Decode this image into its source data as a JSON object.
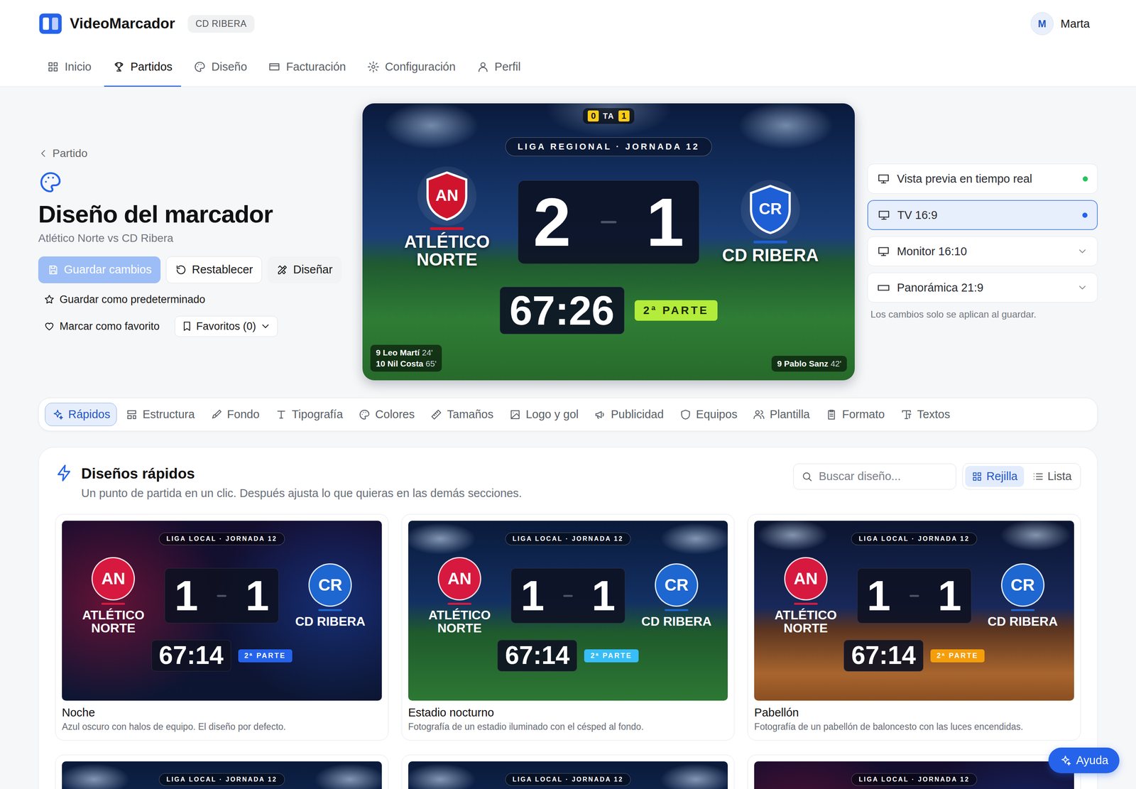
{
  "app": {
    "brand": "VideoMarcador",
    "club": "CD RIBERA",
    "user": {
      "initial": "M",
      "name": "Marta"
    }
  },
  "nav": [
    {
      "label": "Inicio",
      "selected": false
    },
    {
      "label": "Partidos",
      "selected": true
    },
    {
      "label": "Diseño",
      "selected": false
    },
    {
      "label": "Facturación",
      "selected": false
    },
    {
      "label": "Configuración",
      "selected": false
    },
    {
      "label": "Perfil",
      "selected": false
    }
  ],
  "page": {
    "back": "Partido",
    "title": "Diseño del marcador",
    "subtitle": "Atlético Norte vs CD Ribera"
  },
  "actions": {
    "save": {
      "label": "Guardar cambios",
      "disabled": true
    },
    "reset": "Restablecer",
    "design": "Diseñar",
    "default": "Guardar como predeterminado",
    "favorite": "Marcar como favorito",
    "favorites": "Favoritos (0)"
  },
  "preview": {
    "timeouts": {
      "home": "0",
      "label": "TA",
      "away": "1"
    },
    "competition": "LIGA REGIONAL · JORNADA 12",
    "home": {
      "initials": "AN",
      "name": "ATLÉTICO NORTE",
      "color": "#d0142e",
      "scorers": [
        {
          "name": "9 Leo Martí",
          "minute": "24'"
        },
        {
          "name": "10 Nil Costa",
          "minute": "65'"
        }
      ]
    },
    "away": {
      "initials": "CR",
      "name": "CD RIBERA",
      "color": "#1e5fd6",
      "scorers": [
        {
          "name": "9 Pablo Sanz",
          "minute": "42'"
        }
      ]
    },
    "score": {
      "home": "2",
      "away": "1"
    },
    "clock": "67:26",
    "period": "2ª PARTE"
  },
  "screens": {
    "live": {
      "label": "Vista previa en tiempo real",
      "on": true,
      "color": "#22c55e"
    },
    "items": [
      {
        "label": "TV 16:9",
        "selected": true
      },
      {
        "label": "Monitor 16:10",
        "selected": false
      },
      {
        "label": "Panorámica 21:9",
        "selected": false
      }
    ],
    "note": "Los cambios solo se aplican al guardar."
  },
  "sections": [
    {
      "label": "Rápidos",
      "selected": true
    },
    {
      "label": "Estructura",
      "selected": false
    },
    {
      "label": "Fondo",
      "selected": false
    },
    {
      "label": "Tipografía",
      "selected": false
    },
    {
      "label": "Colores",
      "selected": false
    },
    {
      "label": "Tamaños",
      "selected": false
    },
    {
      "label": "Logo y gol",
      "selected": false
    },
    {
      "label": "Publicidad",
      "selected": false
    },
    {
      "label": "Equipos",
      "selected": false
    },
    {
      "label": "Plantilla",
      "selected": false
    },
    {
      "label": "Formato",
      "selected": false
    },
    {
      "label": "Textos",
      "selected": false
    }
  ],
  "quick": {
    "title": "Diseños rápidos",
    "subtitle": "Un punto de partida en un clic. Después ajusta lo que quieras en las demás secciones.",
    "search": "Buscar diseño...",
    "views": [
      {
        "label": "Rejilla",
        "selected": true
      },
      {
        "label": "Lista",
        "selected": false
      }
    ],
    "designs": [
      {
        "name": "Noche",
        "description": "Azul oscuro con halos de equipo. El diseño por defecto.",
        "kind": "night",
        "competition": "LIGA LOCAL · JORNADA 12",
        "home": {
          "initials": "AN",
          "name": "ATLÉTICO NORTE",
          "color": "#d7193f"
        },
        "away": {
          "initials": "CR",
          "name": "CD RIBERA",
          "color": "#1e66d0"
        },
        "score": [
          "1",
          "1"
        ],
        "clock": "67:14",
        "period": "2ª PARTE",
        "color": "#2563eb"
      },
      {
        "name": "Estadio nocturno",
        "description": "Fotografía de un estadio iluminado con el césped al fondo.",
        "kind": "stadium",
        "competition": "LIGA LOCAL · JORNADA 12",
        "home": {
          "initials": "AN",
          "name": "ATLÉTICO NORTE",
          "color": "#d7193f"
        },
        "away": {
          "initials": "CR",
          "name": "CD RIBERA",
          "color": "#1e66d0"
        },
        "score": [
          "1",
          "1"
        ],
        "clock": "67:14",
        "period": "2ª PARTE",
        "color": "#38bdf8"
      },
      {
        "name": "Pabellón",
        "description": "Fotografía de un pabellón de baloncesto con las luces encendidas.",
        "kind": "arena",
        "competition": "LIGA LOCAL · JORNADA 12",
        "home": {
          "initials": "AN",
          "name": "ATLÉTICO NORTE",
          "color": "#d7193f"
        },
        "away": {
          "initials": "CR",
          "name": "CD RIBERA",
          "color": "#1e66d0"
        },
        "score": [
          "1",
          "1"
        ],
        "clock": "67:14",
        "period": "2ª PARTE",
        "color": "#f59e0b"
      }
    ],
    "more": [
      {
        "kind": "stadium",
        "competition": "LIGA LOCAL · JORNADA 12"
      },
      {
        "kind": "stadium",
        "competition": "LIGA LOCAL · JORNADA 12"
      },
      {
        "kind": "night",
        "competition": "LIGA LOCAL · JORNADA 12"
      }
    ]
  },
  "help": "Ayuda"
}
